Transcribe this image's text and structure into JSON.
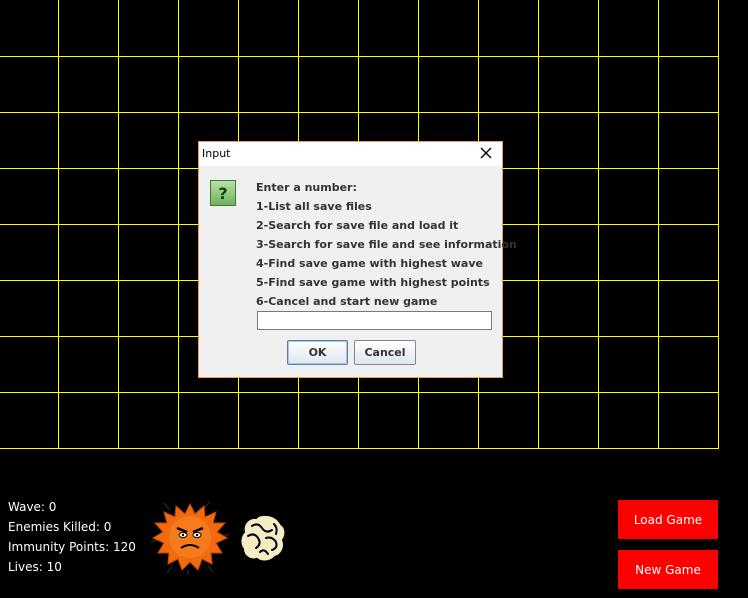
{
  "grid": {
    "line_color": "#ffff00",
    "columns": 12,
    "rows": 8
  },
  "stats": {
    "wave": "Wave: 0",
    "enemies_killed": "Enemies Killed: 0",
    "immunity_points": "Immunity Points: 120",
    "lives": "Lives: 10"
  },
  "buttons": {
    "load_game": "Load Game",
    "new_game": "New Game",
    "color": "#ff0000"
  },
  "sprites": [
    "virus-enemy-icon",
    "immune-cell-tower-icon"
  ],
  "dialog": {
    "title": "Input",
    "icon": "question-icon",
    "icon_glyph": "?",
    "message_lines": [
      "Enter a number:",
      "1-List all save files",
      "2-Search for save file and load it",
      "3-Search for save file and see information",
      "4-Find save game with highest wave",
      "5-Find save game with highest points",
      "6-Cancel and start new game"
    ],
    "input_value": "",
    "ok_label": "OK",
    "cancel_label": "Cancel"
  }
}
